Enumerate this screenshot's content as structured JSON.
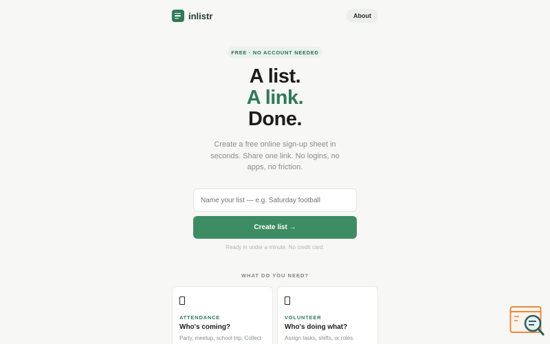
{
  "header": {
    "brand": "inlistr",
    "about_label": "About"
  },
  "badge": "FREE · NO ACCOUNT NEEDED",
  "hero": {
    "line1": "A list.",
    "line2": "A link.",
    "line3": "Done."
  },
  "subtitle": "Create a free online sign-up sheet in seconds. Share one link. No logins, no apps, no friction.",
  "form": {
    "list_name_placeholder": "Name your list — e.g. Saturday football",
    "create_label": "Create list →",
    "hint": "Ready in under a minute. No credit card."
  },
  "section_label": "WHAT DO YOU NEED?",
  "cards": [
    {
      "kicker": "ATTENDANCE",
      "title": "Who's coming?",
      "desc": "Party, meetup, school trip. Collect",
      "icon": "clipboard-icon"
    },
    {
      "kicker": "VOLUNTEER",
      "title": "Who's doing what?",
      "desc": "Assign tasks, shifts, or roles.",
      "icon": "clipboard-icon"
    }
  ],
  "colors": {
    "accent": "#2f7a57",
    "button": "#3d8c63",
    "background": "#f7f7f5"
  }
}
